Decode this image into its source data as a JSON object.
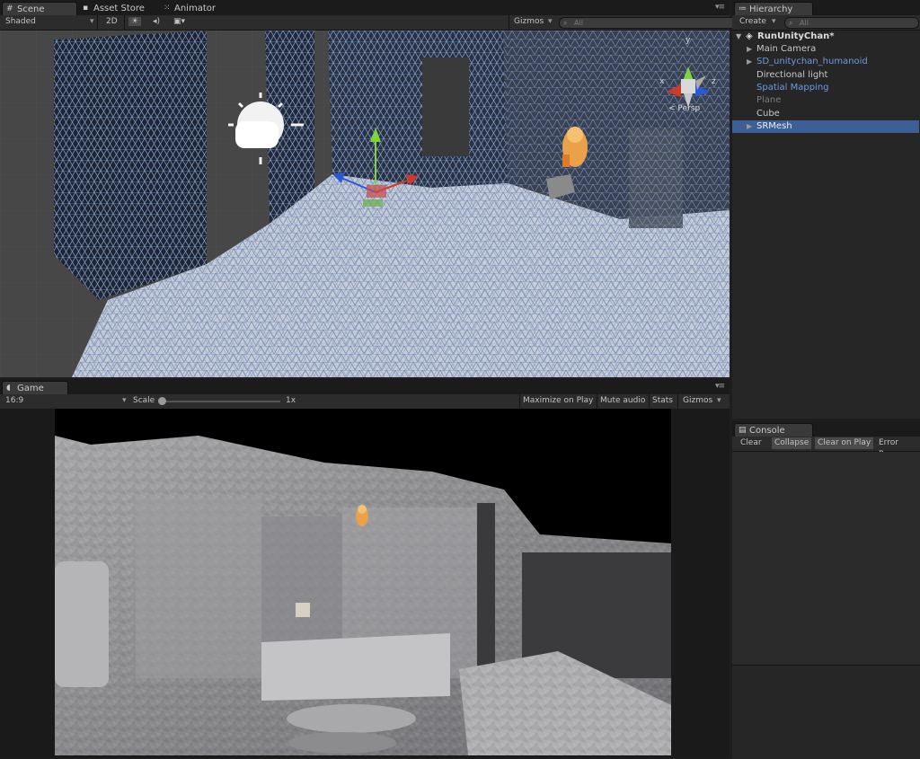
{
  "scene": {
    "tabs": [
      {
        "label": "Scene",
        "icon": "hash-icon"
      },
      {
        "label": "Asset Store",
        "icon": "bag-icon"
      },
      {
        "label": "Animator",
        "icon": "animator-icon"
      }
    ],
    "toolbar": {
      "draw_mode": "Shaded",
      "mode_2d": "2D",
      "gizmos": "Gizmos",
      "search_placeholder": "All"
    },
    "gizmo_axes": {
      "y": "y",
      "x": "x",
      "z": "z"
    },
    "projection": "Persp"
  },
  "game": {
    "tab": "Game",
    "aspect": "16:9",
    "scale_label": "Scale",
    "scale_value": "1x",
    "scale_level": 0.0,
    "buttons": [
      "Maximize on Play",
      "Mute audio",
      "Stats",
      "Gizmos"
    ]
  },
  "hierarchy": {
    "tab": "Hierarchy",
    "create": "Create",
    "search_placeholder": "All",
    "scene_name": "RunUnityChan*",
    "items": [
      {
        "label": "Main Camera",
        "expandable": true,
        "color": "#c8c8c8",
        "selected": false
      },
      {
        "label": "SD_unitychan_humanoid",
        "expandable": true,
        "color": "#6e9be0",
        "selected": false
      },
      {
        "label": "Directional light",
        "expandable": false,
        "color": "#c8c8c8",
        "selected": false
      },
      {
        "label": "Spatial Mapping",
        "expandable": false,
        "color": "#6e9be0",
        "selected": false
      },
      {
        "label": "Plane",
        "expandable": false,
        "color": "#7c7c7c",
        "selected": false
      },
      {
        "label": "Cube",
        "expandable": false,
        "color": "#c8c8c8",
        "selected": false
      },
      {
        "label": "SRMesh",
        "expandable": true,
        "color": "#e8eef8",
        "selected": true
      }
    ]
  },
  "console": {
    "tab": "Console",
    "buttons": [
      {
        "label": "Clear",
        "on": false
      },
      {
        "label": "Collapse",
        "on": true
      },
      {
        "label": "Clear on Play",
        "on": true
      },
      {
        "label": "Error Pause",
        "on": false
      }
    ]
  },
  "colors": {
    "selection": "#3e5f96",
    "prefab_blue": "#6e9be0",
    "mesh_wire": "#7a95c4"
  }
}
